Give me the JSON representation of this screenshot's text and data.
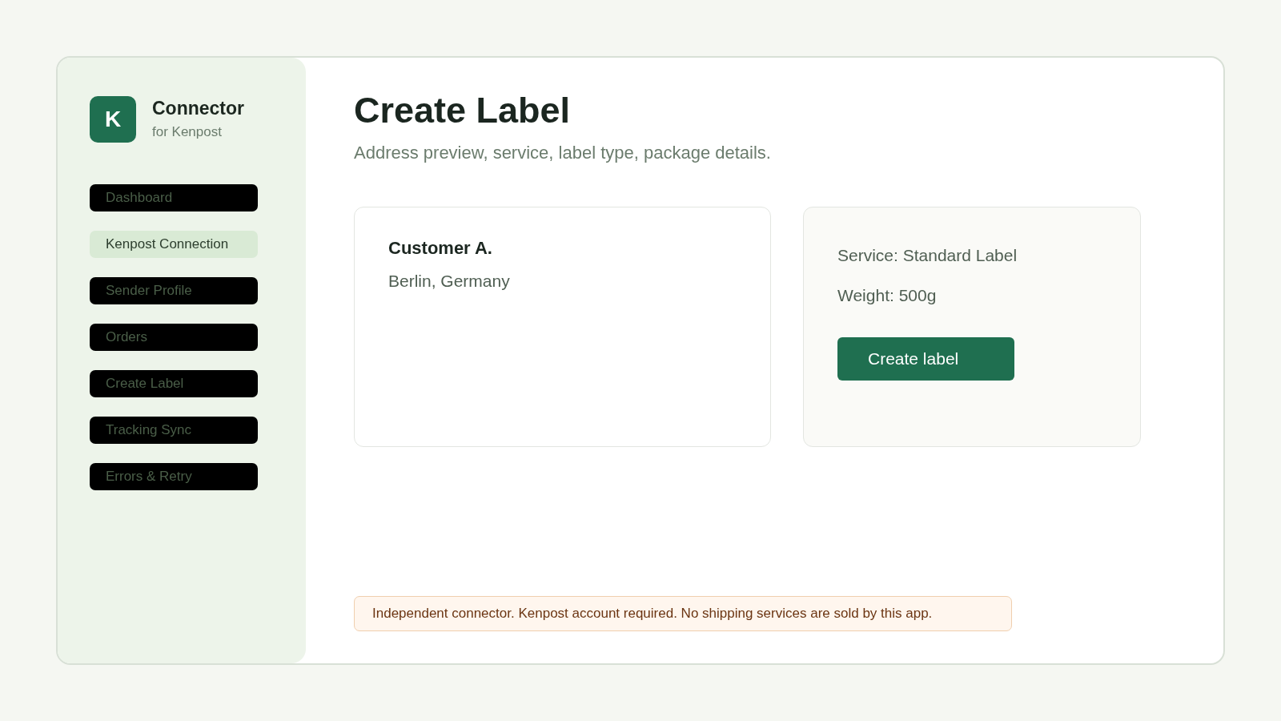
{
  "brand": {
    "logo_letter": "K",
    "title": "Connector",
    "subtitle": "for Kenpost"
  },
  "nav": [
    {
      "label": "Dashboard",
      "selected": false
    },
    {
      "label": "Kenpost Connection",
      "selected": true
    },
    {
      "label": "Sender Profile",
      "selected": false
    },
    {
      "label": "Orders",
      "selected": false
    },
    {
      "label": "Create Label",
      "selected": false
    },
    {
      "label": "Tracking Sync",
      "selected": false
    },
    {
      "label": "Errors & Retry",
      "selected": false
    }
  ],
  "page": {
    "title": "Create Label",
    "subtitle": "Address preview, service, label type, package details."
  },
  "address_card": {
    "name": "Customer A.",
    "location": "Berlin, Germany"
  },
  "details_card": {
    "service": "Service: Standard Label",
    "weight": "Weight: 500g",
    "button": "Create label"
  },
  "notice": "Independent connector. Kenpost account required. No shipping services are sold by this app."
}
